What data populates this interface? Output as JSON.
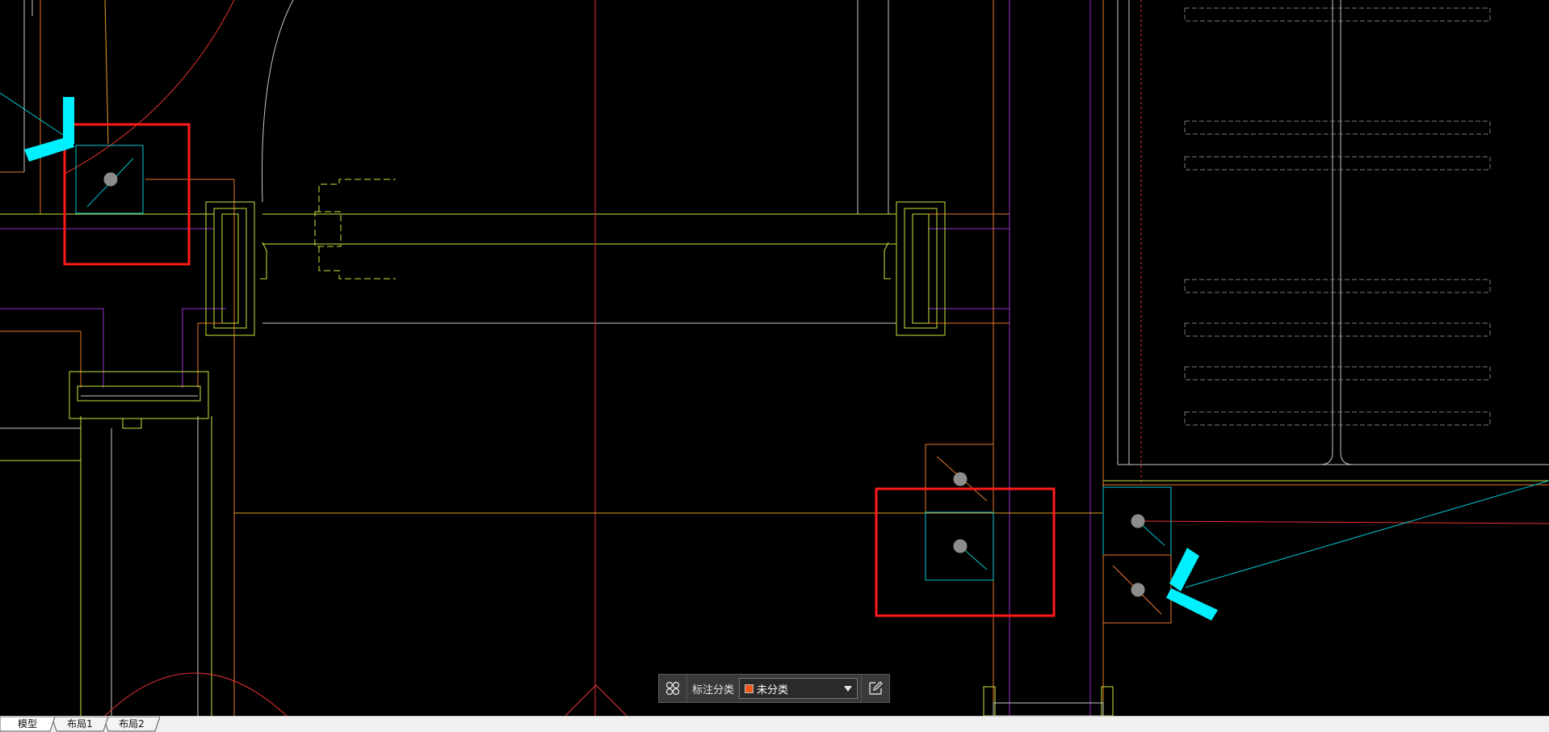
{
  "toolbar": {
    "label": "标注分类",
    "selected_category": "未分类",
    "swatch_color": "#f05a1e",
    "grid_icon": "grid-icon",
    "edit_icon": "edit-icon"
  },
  "tabs": [
    {
      "label": "模型",
      "active": true
    },
    {
      "label": "布局1",
      "active": false
    },
    {
      "label": "布局2",
      "active": false
    }
  ],
  "colors": {
    "background": "#000000",
    "highlight_box": "#ff1a1a",
    "marker_cyan": "#00f0ff",
    "wall_yellow": "#c8e63c",
    "wall_orange": "#e6782d",
    "axis_red": "#e63232",
    "partition_purple": "#9632c8"
  }
}
